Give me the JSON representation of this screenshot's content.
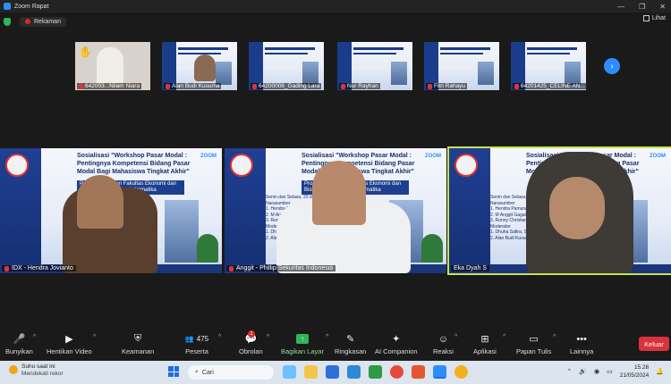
{
  "window": {
    "title": "Zoom Rapat",
    "controls": [
      "—",
      "❐",
      "✕"
    ]
  },
  "topbar": {
    "recording_label": "Rekaman",
    "view_label": "Lihat"
  },
  "thumbnails": [
    {
      "name": "642003...Niiam Niara",
      "muted": true,
      "hand": true
    },
    {
      "name": "Alan Budi Kusuma",
      "muted": true,
      "hand": false
    },
    {
      "name": "64200008_Gading Lara",
      "muted": true,
      "hand": false
    },
    {
      "name": "Nur Rayhan",
      "muted": true,
      "hand": false
    },
    {
      "name": "Fitri Rahayu",
      "muted": true,
      "hand": false
    },
    {
      "name": "64201425_CELINE AN...",
      "muted": true,
      "hand": false
    }
  ],
  "next_page_icon": "chevron-right-icon",
  "tiles": [
    {
      "name": "IDX - Hendra Jovianto",
      "muted": true,
      "speaking": false
    },
    {
      "name": "Anggit - Phillip Sekuritas Indonesia",
      "muted": true,
      "speaking": false
    },
    {
      "name": "Eka Dyah S",
      "muted": false,
      "speaking": true
    }
  ],
  "slide": {
    "title": "Sosialisasi \"Workshop Pasar Modal : Pentingnya Kompetensi Bidang Pasar Modal Bagi Mahasiswa Tingkat Akhir\"",
    "subtitle": "Prodi Manajemen Fakultas Ekonomi dan Bisnis Untuk Sarana Informatika",
    "date": "Senin dan Selasa, 20 dan 21 Mei 2024",
    "narasumber": "Narasumber",
    "speakers": [
      "1. Hendra Pamungkas Jovianto",
      "2. M Anggit Gagal",
      "3. Ronny Christian"
    ],
    "moderator": "Moderator",
    "moderators": [
      "1. Dhuha Safira, SE, M.M",
      "2. Alan Budi Kusuma, SE, MM"
    ],
    "zoom_label": "ZOOM"
  },
  "toolbar": {
    "mute": "Bunyikan",
    "stop_video": "Hentikan Video",
    "security": "Keamanan",
    "participants": "Peserta",
    "participants_count": "475",
    "chat": "Obrolan",
    "chat_badge": "1",
    "share": "Bagikan Layar",
    "summary": "Ringkasan",
    "companion": "AI Companion",
    "reactions": "Reaksi",
    "apps": "Aplikasi",
    "whiteboard": "Papan Tulis",
    "more": "Lainnya",
    "leave": "Keluar"
  },
  "taskbar": {
    "weather_title": "Suhu saat ini",
    "weather_sub": "Mendekati rekor",
    "search_placeholder": "Cari",
    "time": "15.26",
    "date": "21/05/2024"
  },
  "colors": {
    "accent": "#2d8cff",
    "leave": "#d9323a",
    "share": "#2fb45a",
    "speaker_outline": "#c9e24a"
  }
}
